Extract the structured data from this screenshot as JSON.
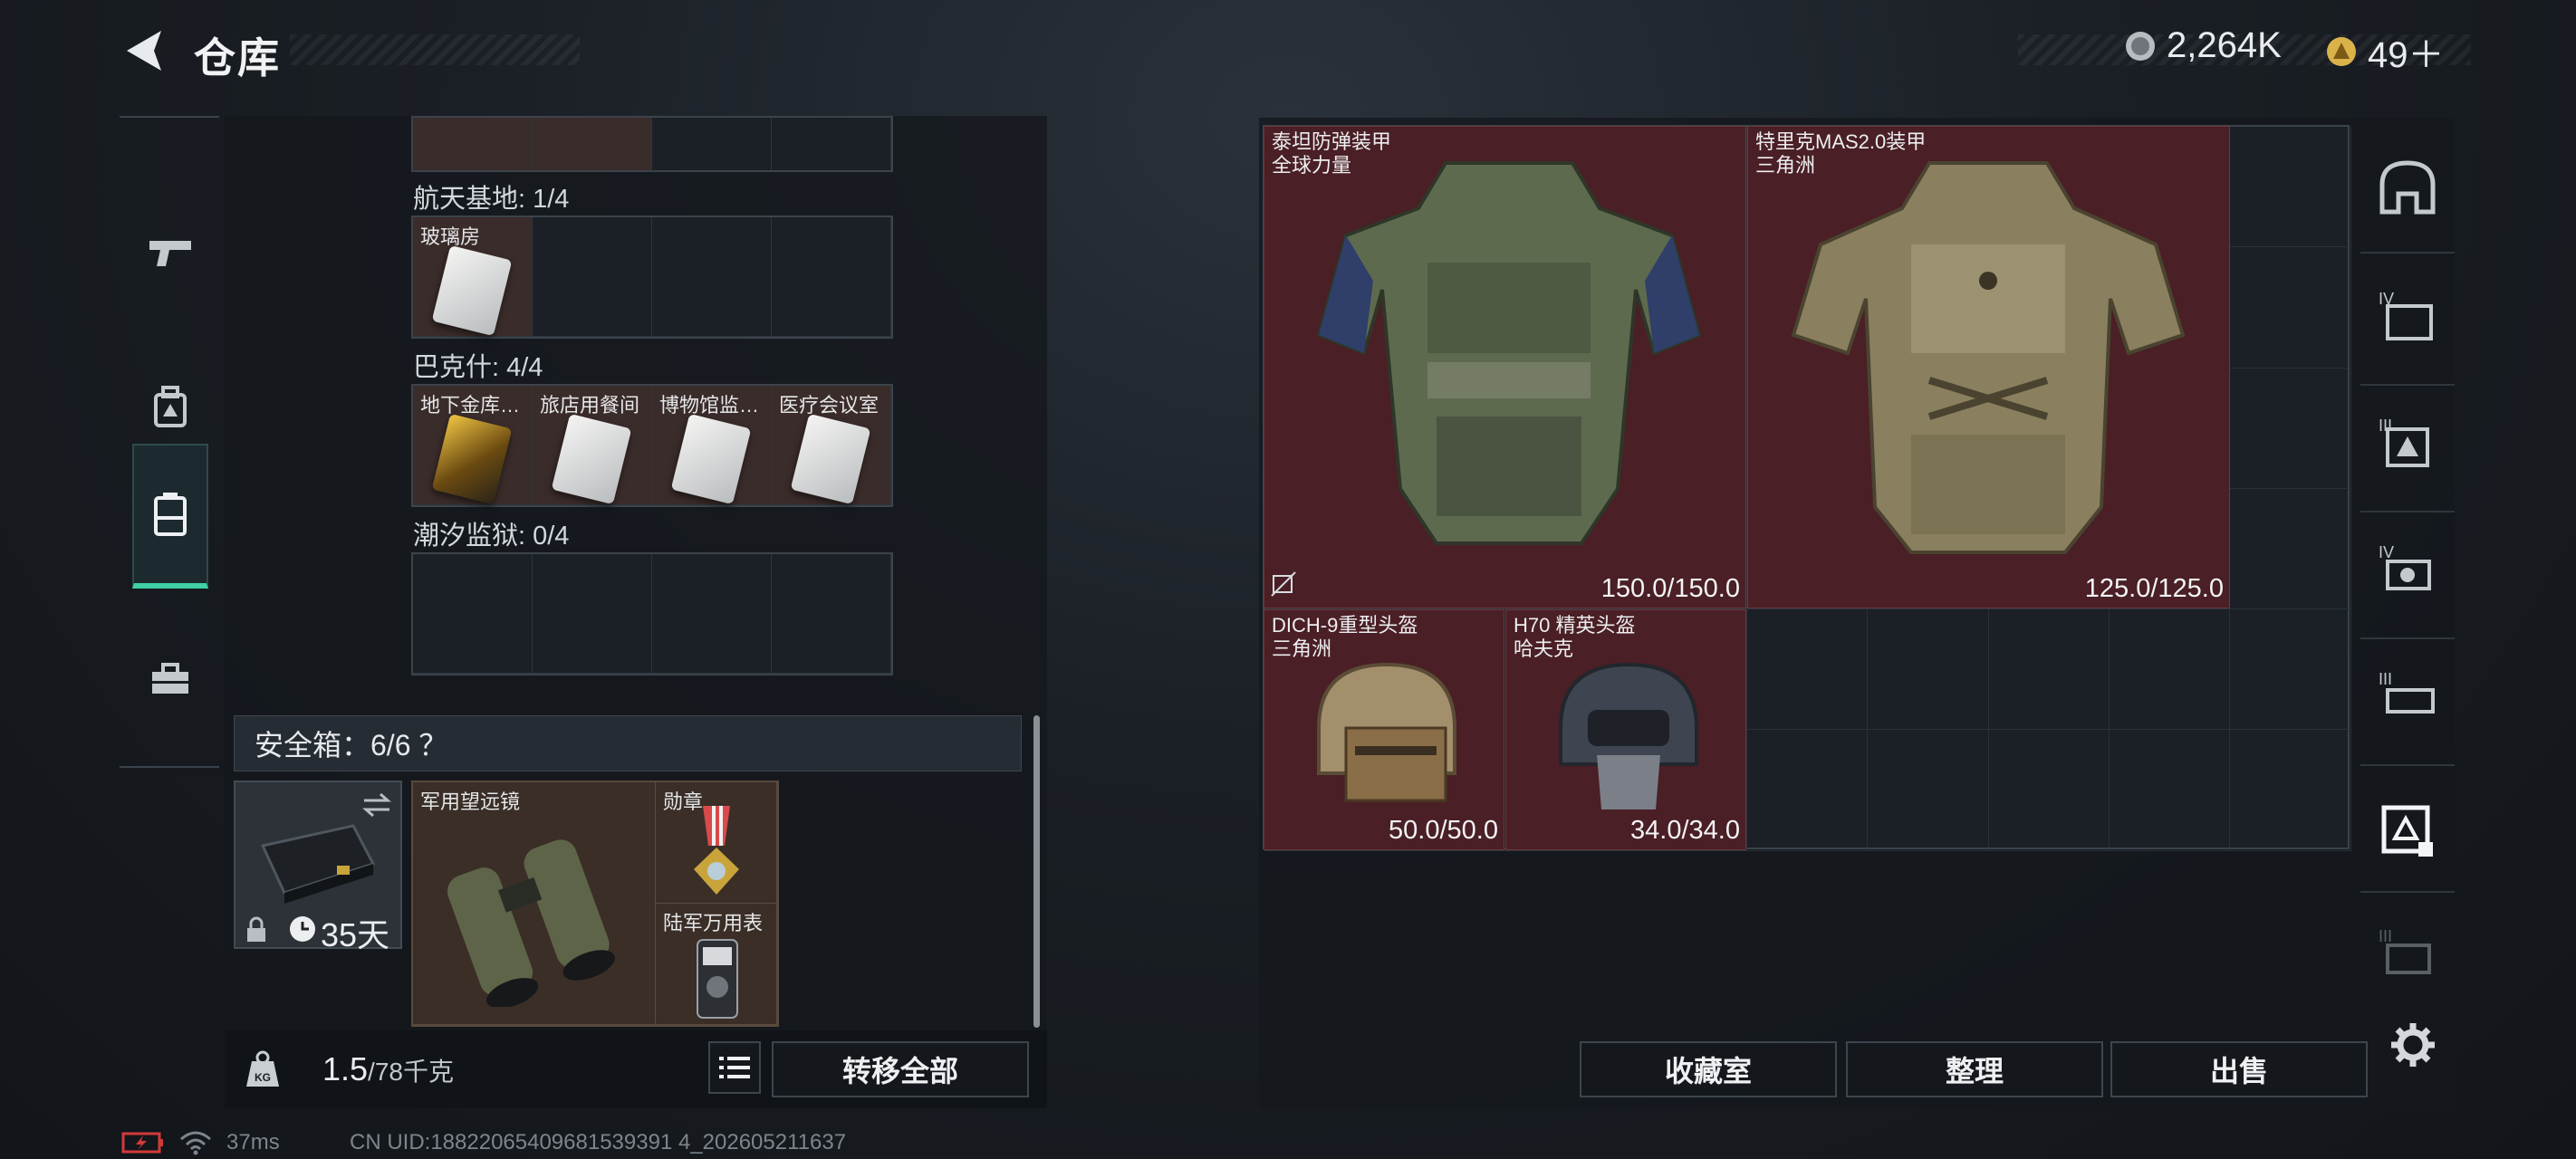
{
  "header": {
    "title": "仓库",
    "currency_1": "2,264K",
    "currency_2": "49＋"
  },
  "left_nav": [
    "weapon",
    "backpack",
    "storage",
    "toolbox"
  ],
  "stash": {
    "sections": [
      {
        "label": "航天基地: 1/4",
        "items": [
          {
            "name": "玻璃房",
            "gold": false
          }
        ]
      },
      {
        "label": "巴克什: 4/4",
        "items": [
          {
            "name": "地下金库…",
            "gold": true
          },
          {
            "name": "旅店用餐间",
            "gold": false
          },
          {
            "name": "博物馆监…",
            "gold": false
          },
          {
            "name": "医疗会议室",
            "gold": false
          }
        ]
      },
      {
        "label": "潮汐监狱: 0/4",
        "items": []
      }
    ]
  },
  "safe": {
    "label": "安全箱：6/6 ？",
    "days": "35天",
    "items": {
      "binoculars": "军用望远镜",
      "medal": "勋章",
      "watch": "陆军万用表"
    }
  },
  "bottom": {
    "weight": "1.5",
    "weight_max": "/78千克",
    "transfer_all": "转移全部"
  },
  "equipment": [
    {
      "name": "泰坦防弹装甲",
      "sub": "全球力量",
      "durability": "150.0/150.0"
    },
    {
      "name": "特里克MAS2.0装甲",
      "sub": "三角洲",
      "durability": "125.0/125.0"
    },
    {
      "name": "DICH-9重型头盔",
      "sub": "三角洲",
      "durability": "50.0/50.0"
    },
    {
      "name": "H70 精英头盔",
      "sub": "哈夫克",
      "durability": "34.0/34.0"
    }
  ],
  "right_tabs": [
    "IV",
    "III",
    "IV",
    "III",
    "III"
  ],
  "actions": {
    "collection": "收藏室",
    "organize": "整理",
    "sell": "出售"
  },
  "status": {
    "ping": "37ms",
    "uid": "CN UID:18822065409681539391 4_202605211637"
  },
  "colors": {
    "accent": "#3fd0a6",
    "item_bg": "#4a1f25"
  }
}
